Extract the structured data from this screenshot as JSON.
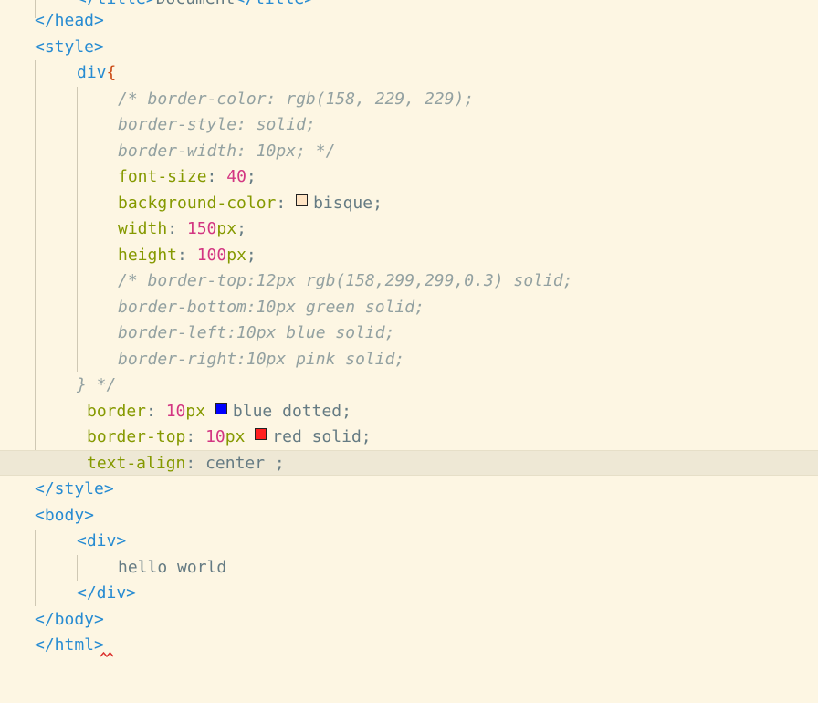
{
  "editor": {
    "lines": {
      "l0": {
        "t1": "</title>",
        "t2": "Document",
        "t3": "</title>"
      },
      "l1": "</head>",
      "l2": "<style>",
      "l3": {
        "sel": "div",
        "brace": "{"
      },
      "l4": "/* border-color: rgb(158, 229, 229);",
      "l5": "border-style: solid;",
      "l6": "border-width: 10px; */",
      "l7": {
        "prop": "font-size",
        "colon": ": ",
        "num": "40",
        "end": ";"
      },
      "l8": {
        "prop": "background-color",
        "colon": ": ",
        "value": "bisque;"
      },
      "l9": {
        "prop": "width",
        "colon": ": ",
        "num": "150",
        "unit": "px",
        "end": ";"
      },
      "l10": {
        "prop": "height",
        "colon": ": ",
        "num": "100",
        "unit": "px",
        "end": ";"
      },
      "l11": "/* border-top:12px rgb(158,299,299,0.3) solid;",
      "l12": "border-bottom:10px green solid;",
      "l13": "border-left:10px blue solid;",
      "l14": "border-right:10px pink solid;",
      "l15": "} */",
      "l16": {
        "prop": "border",
        "colon": ": ",
        "num": "10",
        "unit": "px ",
        "value": "blue dotted;"
      },
      "l17": {
        "prop": "border-top",
        "colon": ": ",
        "num": "10",
        "unit": "px ",
        "value": "red solid;"
      },
      "l18": {
        "prop": "text-align",
        "colon": ": ",
        "value": "center ;"
      },
      "l19": "</style>",
      "l20": "<body>",
      "l21": "<div>",
      "l22": "hello world",
      "l23": "</div>",
      "l24": "</body>",
      "l25": "</html>"
    },
    "swatches": {
      "bisque": "#ffe4c4",
      "blue": "#0000ff",
      "red": "#ff2020"
    },
    "theme": {
      "background": "#fdf6e3",
      "current_line": "#eee8d5",
      "tag": "#268bd2",
      "keyword": "#859900",
      "number": "#d33682",
      "comment": "#93a1a1"
    }
  }
}
